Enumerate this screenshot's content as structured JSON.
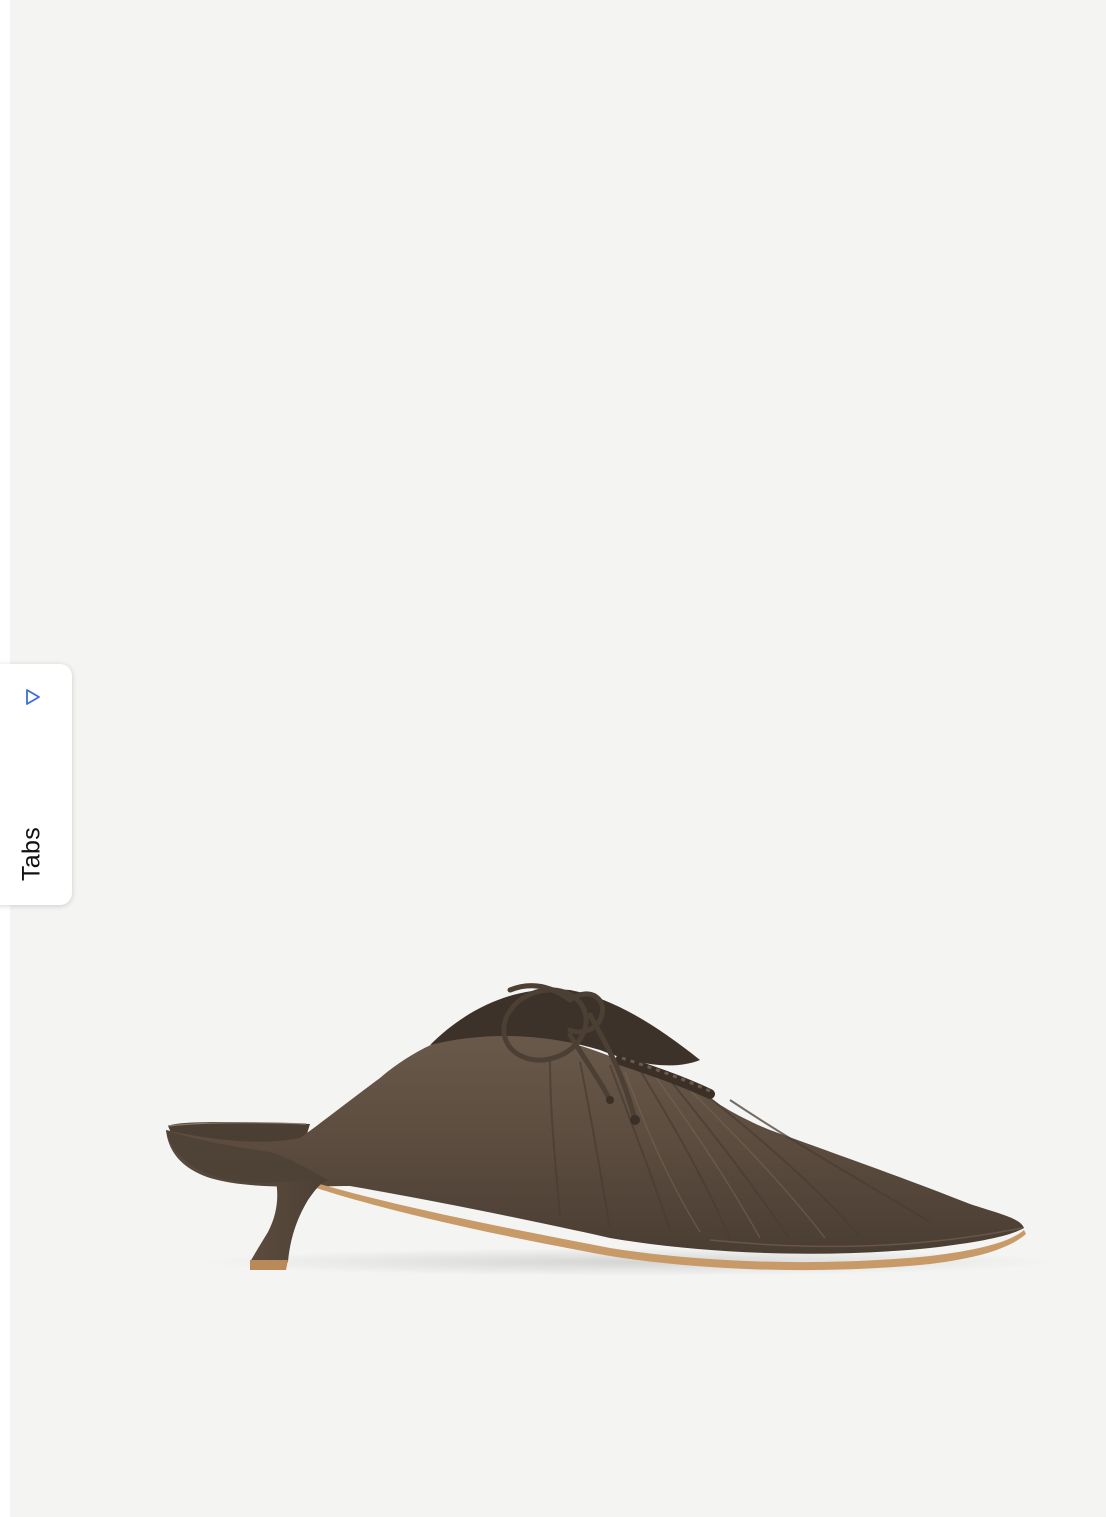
{
  "side_tab": {
    "label": "Tabs",
    "icon": "play-triangle-icon",
    "icon_color": "#3b6fd8"
  },
  "product": {
    "image_subject": "brown-leather-kitten-heel-mule",
    "background_color": "#f4f4f3",
    "leather_color": "#5a4b3e",
    "sole_color": "#c79a68"
  }
}
